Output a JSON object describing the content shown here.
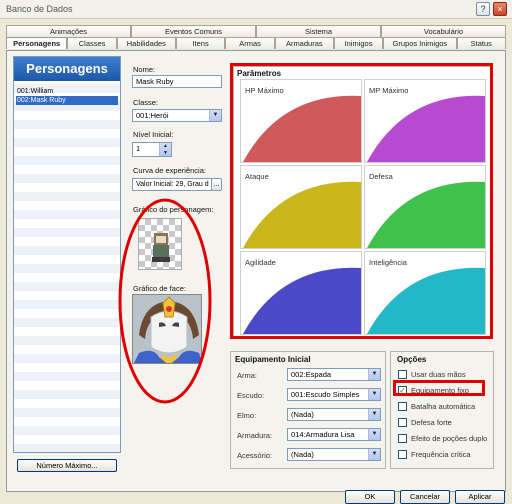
{
  "window": {
    "title": "Banco de Dados",
    "help_glyph": "?",
    "close_glyph": "×"
  },
  "tabs_row1": [
    "Animações",
    "Eventos Comuns",
    "Sistema",
    "Vocabulário"
  ],
  "tabs_row2": [
    "Personagens",
    "Classes",
    "Habilidades",
    "Itens",
    "Armas",
    "Armaduras",
    "Inimigos",
    "Grupos Inimigos",
    "Status"
  ],
  "list": {
    "header": "Personagens",
    "items": [
      "001:William",
      "002:Mask Ruby"
    ],
    "selected_index": 1,
    "max_button": "Número Máximo..."
  },
  "form": {
    "name_label": "Nome:",
    "name_value": "Mask Ruby",
    "class_label": "Classe:",
    "class_value": "001:Herói",
    "level_label": "Nível Inicial:",
    "level_value": "1",
    "exp_label": "Curva de experiência:",
    "exp_value": "Valor Inicial: 29, Grau d",
    "exp_button": "...",
    "char_graphic_label": "Gráfico do personagem:",
    "face_graphic_label": "Gráfico de face:"
  },
  "params": {
    "title": "Parâmetros",
    "cells": [
      {
        "label": "HP Máximo",
        "color": "#d05a5a"
      },
      {
        "label": "MP Máximo",
        "color": "#b74ad0"
      },
      {
        "label": "Ataque",
        "color": "#c9b61a"
      },
      {
        "label": "Defesa",
        "color": "#3fc24c"
      },
      {
        "label": "Agilidade",
        "color": "#4b49c8"
      },
      {
        "label": "Inteligência",
        "color": "#22b8c8"
      }
    ]
  },
  "equipment": {
    "title": "Equipamento Inicial",
    "rows": [
      {
        "label": "Arma:",
        "value": "002:Espada"
      },
      {
        "label": "Escudo:",
        "value": "001:Escudo Simples"
      },
      {
        "label": "Elmo:",
        "value": "(Nada)"
      },
      {
        "label": "Armadura:",
        "value": "014:Armadura Lisa"
      },
      {
        "label": "Acessório:",
        "value": "(Nada)"
      }
    ]
  },
  "options": {
    "title": "Opções",
    "items": [
      {
        "label": "Usar duas mãos",
        "checked": false
      },
      {
        "label": "Equipamento fixo",
        "checked": true
      },
      {
        "label": "Batalha automática",
        "checked": false
      },
      {
        "label": "Defesa forte",
        "checked": false
      },
      {
        "label": "Efeito de poções duplo",
        "checked": false
      },
      {
        "label": "Frequência crítica",
        "checked": false
      }
    ]
  },
  "footer": {
    "ok": "OK",
    "cancel": "Cancelar",
    "apply": "Aplicar"
  },
  "colors": {
    "annotation": "#e00000",
    "list_header": "#2a6ac0"
  }
}
